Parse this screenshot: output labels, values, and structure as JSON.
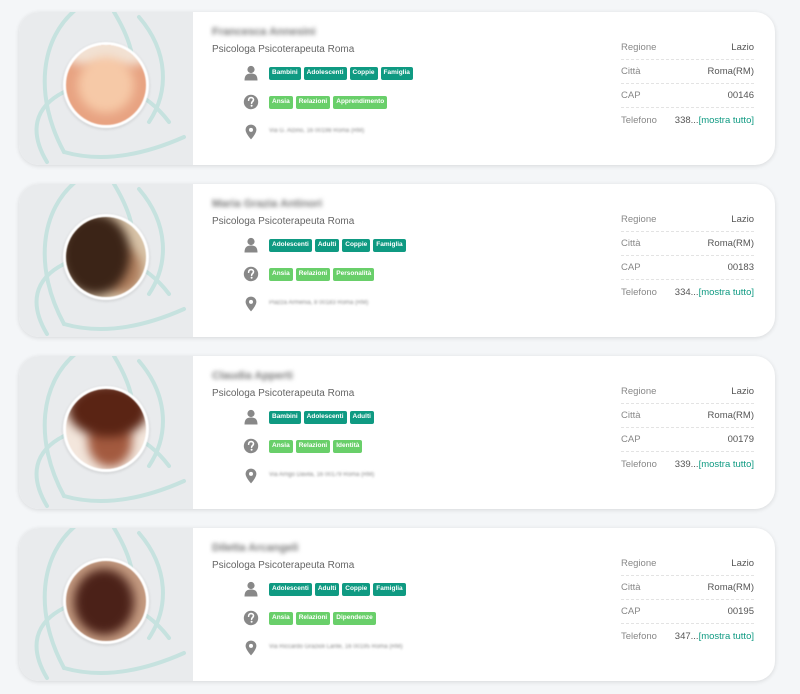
{
  "colors": {
    "tag_dark": "#0f9a82",
    "tag_light": "#69cf6a",
    "link": "#0f9a82"
  },
  "icons": {
    "target": "person-icon",
    "problems": "question-circle-icon",
    "address": "map-pin-icon"
  },
  "labels": {
    "region": "Regione",
    "city": "Città",
    "cap": "CAP",
    "phone": "Telefono",
    "show_all": "[mostra tutto]"
  },
  "cards": [
    {
      "name": "Francesca Annesini",
      "profession": "Psicologa Psicoterapeuta Roma",
      "targets": [
        "Bambini",
        "Adolescenti",
        "Coppie",
        "Famiglia"
      ],
      "issues": [
        "Ansia",
        "Relazioni",
        "Apprendimento"
      ],
      "address": "Via G. Alzino, 16 00198 Roma (RM)",
      "region": "Lazio",
      "city": "Roma(RM)",
      "cap": "00146",
      "phone": "338..."
    },
    {
      "name": "Maria Grazia Antinori",
      "profession": "Psicologa Psicoterapeuta Roma",
      "targets": [
        "Adolescenti",
        "Adulti",
        "Coppie",
        "Famiglia"
      ],
      "issues": [
        "Ansia",
        "Relazioni",
        "Personalità"
      ],
      "address": "Piazza Armenia, 8 00183 Roma (RM)",
      "region": "Lazio",
      "city": "Roma(RM)",
      "cap": "00183",
      "phone": "334..."
    },
    {
      "name": "Claudia Apperti",
      "profession": "Psicologa Psicoterapeuta Roma",
      "targets": [
        "Bambini",
        "Adolescenti",
        "Adulti"
      ],
      "issues": [
        "Ansia",
        "Relazioni",
        "Identità"
      ],
      "address": "Via Arrigo Davila, 16 00179 Roma (RM)",
      "region": "Lazio",
      "city": "Roma(RM)",
      "cap": "00179",
      "phone": "339..."
    },
    {
      "name": "Diletta Arcangeli",
      "profession": "Psicologa Psicoterapeuta Roma",
      "targets": [
        "Adolescenti",
        "Adulti",
        "Coppie",
        "Famiglia"
      ],
      "issues": [
        "Ansia",
        "Relazioni",
        "Dipendenze"
      ],
      "address": "Via Riccardo Grazioli Lante, 16 00195 Roma (RM)",
      "region": "Lazio",
      "city": "Roma(RM)",
      "cap": "00195",
      "phone": "347..."
    }
  ]
}
